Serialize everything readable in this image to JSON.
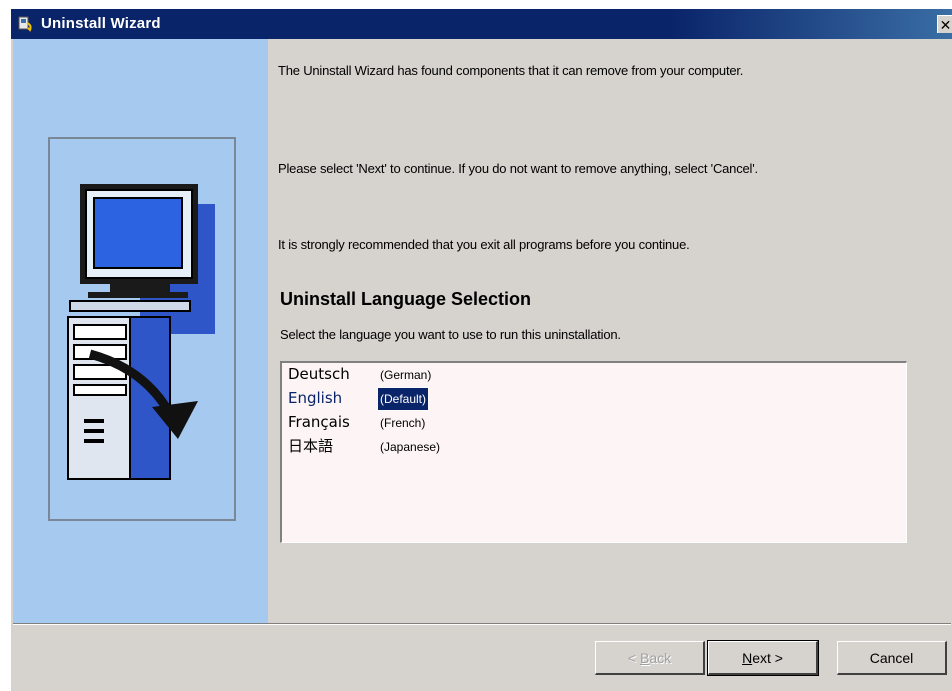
{
  "window": {
    "title": "Uninstall Wizard",
    "close_glyph": "✕"
  },
  "content": {
    "message_found": "The Uninstall Wizard has found components that it can remove from your computer.",
    "message_continue": "Please select 'Next' to continue.  If you do not want to remove anything, select 'Cancel'.",
    "message_recommend": "It is strongly recommended that you exit all programs before you continue.",
    "section_heading": "Uninstall Language Selection",
    "section_description": "Select the language you want to use to run this uninstallation."
  },
  "languages": [
    {
      "name": "Deutsch",
      "note": "(German)",
      "selected": false
    },
    {
      "name": "English",
      "note": "(Default)",
      "selected": true
    },
    {
      "name": "Français",
      "note": "(French)",
      "selected": false
    },
    {
      "name": "日本語",
      "note": "(Japanese)",
      "selected": false
    }
  ],
  "buttons": {
    "back_prefix": "< ",
    "back_accel": "B",
    "back_rest": "ack",
    "next_accel": "N",
    "next_rest": "ext >",
    "cancel": "Cancel"
  },
  "colors": {
    "title_bar": "#0a246a",
    "side_panel": "#a6c9f0",
    "selection": "#0a246a"
  },
  "icons": {
    "title": "uninstall-wizard-icon",
    "art": "computer-uninstall-illustration"
  }
}
